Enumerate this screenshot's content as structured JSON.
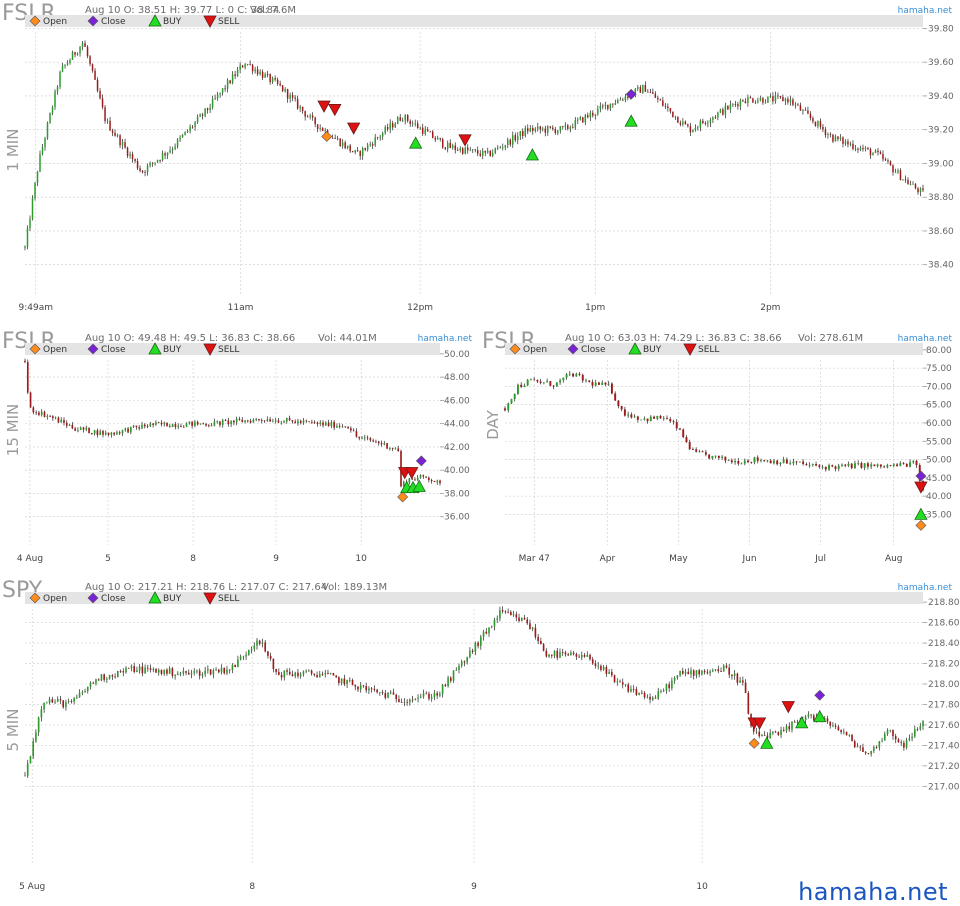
{
  "watermark": "hamaha.net",
  "colors": {
    "up": "#2e9a2e",
    "down": "#9c1a1a",
    "grid": "#cccccc",
    "legend_bg": "#e4e4e4",
    "open": "#ff8c1a",
    "close": "#7a22d6",
    "buy": "#22dd22",
    "sell": "#dd1111",
    "source": "#3a8fd4"
  },
  "legend": {
    "open": "Open",
    "close": "Close",
    "buy": "BUY",
    "sell": "SELL"
  },
  "chart_data": [
    {
      "type": "candlestick",
      "symbol": "FSLR",
      "timeframe": "1 MIN",
      "info": "Aug 10 O: 38.51 H: 39.77 L: 0 C: 38.84",
      "volume": "Vol: 7.6M",
      "source": "hamaha.net",
      "ylim": [
        38.25,
        39.85
      ],
      "yticks": [
        "39.80",
        "39.60",
        "39.40",
        "39.20",
        "39.00",
        "38.80",
        "38.60",
        "38.40"
      ],
      "xticks": [
        "9:49am",
        "11am",
        "12pm",
        "1pm",
        "2pm"
      ],
      "anchors": [
        [
          0,
          38.5
        ],
        [
          0.015,
          39.0
        ],
        [
          0.04,
          39.55
        ],
        [
          0.065,
          39.72
        ],
        [
          0.09,
          39.25
        ],
        [
          0.13,
          38.95
        ],
        [
          0.165,
          39.1
        ],
        [
          0.2,
          39.3
        ],
        [
          0.245,
          39.6
        ],
        [
          0.285,
          39.45
        ],
        [
          0.32,
          39.25
        ],
        [
          0.37,
          39.05
        ],
        [
          0.42,
          39.28
        ],
        [
          0.47,
          39.1
        ],
        [
          0.515,
          39.05
        ],
        [
          0.56,
          39.2
        ],
        [
          0.6,
          39.2
        ],
        [
          0.65,
          39.35
        ],
        [
          0.69,
          39.45
        ],
        [
          0.74,
          39.2
        ],
        [
          0.8,
          39.38
        ],
        [
          0.85,
          39.38
        ],
        [
          0.9,
          39.15
        ],
        [
          0.95,
          39.05
        ],
        [
          0.98,
          38.9
        ],
        [
          1.0,
          38.82
        ]
      ],
      "markers": [
        {
          "kind": "open",
          "t": 0.336,
          "v": 39.16
        },
        {
          "kind": "sell",
          "t": 0.333,
          "v": 39.34
        },
        {
          "kind": "sell",
          "t": 0.345,
          "v": 39.32
        },
        {
          "kind": "sell",
          "t": 0.366,
          "v": 39.21
        },
        {
          "kind": "buy",
          "t": 0.435,
          "v": 39.12
        },
        {
          "kind": "sell",
          "t": 0.49,
          "v": 39.14
        },
        {
          "kind": "buy",
          "t": 0.565,
          "v": 39.05
        },
        {
          "kind": "close",
          "t": 0.675,
          "v": 39.41
        },
        {
          "kind": "buy",
          "t": 0.675,
          "v": 39.25
        }
      ]
    },
    {
      "type": "candlestick",
      "symbol": "FSLR",
      "timeframe": "15 MIN",
      "info": "Aug 10 O: 49.48 H: 49.5 L: 36.83 C: 38.66",
      "volume": "Vol: 44.01M",
      "source": "hamaha.net",
      "ylim": [
        34,
        50.5
      ],
      "yticks": [
        "50.00",
        "48.00",
        "46.00",
        "44.00",
        "42.00",
        "40.00",
        "38.00",
        "36.00"
      ],
      "xticks": [
        "4 Aug",
        "5",
        "8",
        "9",
        "10"
      ],
      "anchors": [
        [
          0,
          49.4
        ],
        [
          0.01,
          45.3
        ],
        [
          0.06,
          44.6
        ],
        [
          0.12,
          43.6
        ],
        [
          0.2,
          43.1
        ],
        [
          0.3,
          43.9
        ],
        [
          0.45,
          44.0
        ],
        [
          0.58,
          44.4
        ],
        [
          0.7,
          44.0
        ],
        [
          0.78,
          43.8
        ],
        [
          0.8,
          42.8
        ],
        [
          0.85,
          42.4
        ],
        [
          0.88,
          42.0
        ],
        [
          0.9,
          41.7
        ],
        [
          0.905,
          38.5
        ],
        [
          0.92,
          39.2
        ],
        [
          0.94,
          39.3
        ],
        [
          0.97,
          39.4
        ],
        [
          0.99,
          39.0
        ],
        [
          1.0,
          38.7
        ]
      ],
      "markers": [
        {
          "kind": "open",
          "t": 0.91,
          "v": 37.7
        },
        {
          "kind": "sell",
          "t": 0.915,
          "v": 39.8
        },
        {
          "kind": "sell",
          "t": 0.932,
          "v": 39.8
        },
        {
          "kind": "buy",
          "t": 0.92,
          "v": 38.5
        },
        {
          "kind": "buy",
          "t": 0.935,
          "v": 38.5
        },
        {
          "kind": "buy",
          "t": 0.95,
          "v": 38.6
        },
        {
          "kind": "close",
          "t": 0.955,
          "v": 40.8
        }
      ]
    },
    {
      "type": "candlestick",
      "symbol": "FSLR",
      "timeframe": "DAY",
      "info": "Aug 10 O: 63.03 H: 74.29 L: 36.83 C: 38.66",
      "volume": "Vol: 278.61M",
      "source": "hamaha.net",
      "ylim": [
        28,
        80.5
      ],
      "yticks": [
        "80.00",
        "75.00",
        "70.00",
        "65.00",
        "60.00",
        "55.00",
        "50.00",
        "45.00",
        "40.00",
        "35.00"
      ],
      "xticks": [
        "Mar 47",
        "Apr",
        "May",
        "Jun",
        "Jul",
        "Aug"
      ],
      "anchors": [
        [
          0,
          64
        ],
        [
          0.03,
          70
        ],
        [
          0.06,
          71.5
        ],
        [
          0.12,
          70.5
        ],
        [
          0.16,
          73.5
        ],
        [
          0.2,
          71
        ],
        [
          0.25,
          70
        ],
        [
          0.28,
          63
        ],
        [
          0.33,
          61
        ],
        [
          0.38,
          61.5
        ],
        [
          0.41,
          59
        ],
        [
          0.45,
          52
        ],
        [
          0.5,
          50.5
        ],
        [
          0.55,
          49.5
        ],
        [
          0.6,
          50
        ],
        [
          0.65,
          49.5
        ],
        [
          0.7,
          49
        ],
        [
          0.75,
          48
        ],
        [
          0.8,
          48
        ],
        [
          0.85,
          48.5
        ],
        [
          0.9,
          48
        ],
        [
          0.95,
          48.5
        ],
        [
          0.985,
          49
        ],
        [
          0.99,
          44
        ],
        [
          1.0,
          42
        ]
      ],
      "markers": [
        {
          "kind": "close",
          "t": 0.995,
          "v": 45.5
        },
        {
          "kind": "sell",
          "t": 0.995,
          "v": 42.5
        },
        {
          "kind": "buy",
          "t": 0.995,
          "v": 35
        },
        {
          "kind": "open",
          "t": 0.995,
          "v": 32
        }
      ]
    },
    {
      "type": "candlestick",
      "symbol": "SPY",
      "timeframe": "5 MIN",
      "info": "Aug 10 O: 217.21 H: 218.76 L: 217.07 C: 217.64",
      "volume": "Vol: 189.13M",
      "source": "hamaha.net",
      "ylim": [
        216.3,
        218.85
      ],
      "yticks": [
        "218.80",
        "218.60",
        "218.40",
        "218.20",
        "218.00",
        "217.80",
        "217.60",
        "217.40",
        "217.20",
        "217.00"
      ],
      "xticks": [
        "5 Aug",
        "8",
        "9",
        "10"
      ],
      "anchors": [
        [
          0,
          217.1
        ],
        [
          0.02,
          217.85
        ],
        [
          0.05,
          217.8
        ],
        [
          0.08,
          218.05
        ],
        [
          0.12,
          218.15
        ],
        [
          0.18,
          218.1
        ],
        [
          0.23,
          218.15
        ],
        [
          0.26,
          218.45
        ],
        [
          0.28,
          218.1
        ],
        [
          0.33,
          218.1
        ],
        [
          0.38,
          217.95
        ],
        [
          0.42,
          217.85
        ],
        [
          0.46,
          217.9
        ],
        [
          0.5,
          218.35
        ],
        [
          0.53,
          218.7
        ],
        [
          0.56,
          218.6
        ],
        [
          0.58,
          218.3
        ],
        [
          0.63,
          218.25
        ],
        [
          0.66,
          218.0
        ],
        [
          0.7,
          217.85
        ],
        [
          0.73,
          218.1
        ],
        [
          0.78,
          218.15
        ],
        [
          0.8,
          218.0
        ],
        [
          0.81,
          217.5
        ],
        [
          0.84,
          217.5
        ],
        [
          0.87,
          217.7
        ],
        [
          0.9,
          217.6
        ],
        [
          0.92,
          217.45
        ],
        [
          0.94,
          217.3
        ],
        [
          0.96,
          217.55
        ],
        [
          0.98,
          217.4
        ],
        [
          1.0,
          217.64
        ]
      ],
      "markers": [
        {
          "kind": "open",
          "t": 0.812,
          "v": 217.42
        },
        {
          "kind": "sell",
          "t": 0.812,
          "v": 217.62
        },
        {
          "kind": "sell",
          "t": 0.818,
          "v": 217.62
        },
        {
          "kind": "buy",
          "t": 0.826,
          "v": 217.42
        },
        {
          "kind": "sell",
          "t": 0.85,
          "v": 217.78
        },
        {
          "kind": "buy",
          "t": 0.865,
          "v": 217.62
        },
        {
          "kind": "close",
          "t": 0.885,
          "v": 217.89
        },
        {
          "kind": "buy",
          "t": 0.885,
          "v": 217.68
        }
      ]
    }
  ]
}
